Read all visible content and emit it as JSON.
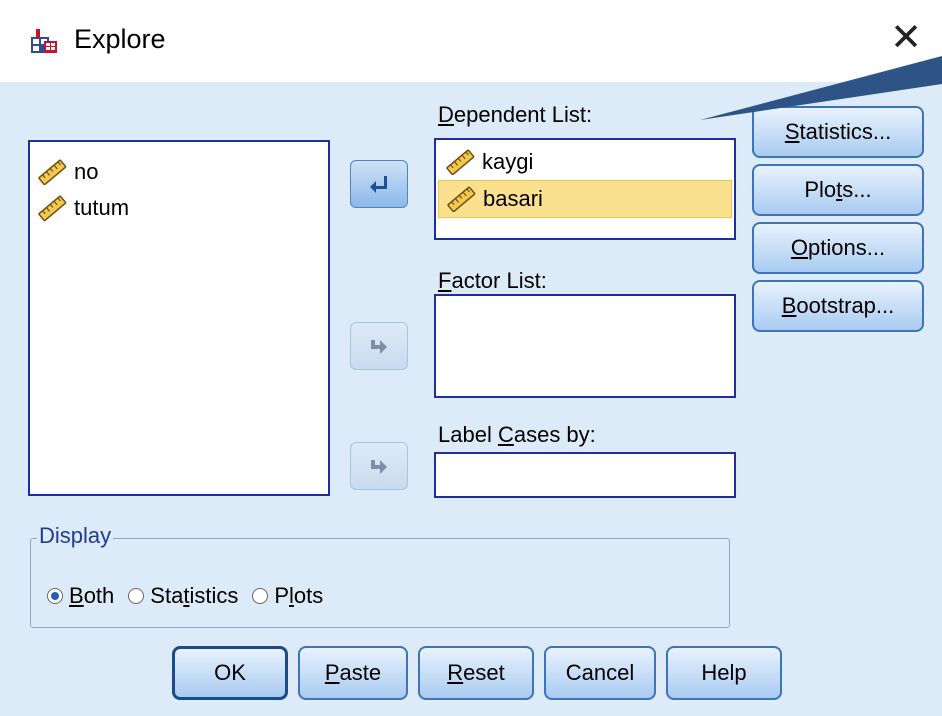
{
  "window": {
    "title": "Explore",
    "close_glyph": "✕",
    "icon": "spss-explore-icon"
  },
  "source_list": {
    "items": [
      {
        "label": "no",
        "icon": "scale-ruler-icon"
      },
      {
        "label": "tutum",
        "icon": "scale-ruler-icon"
      }
    ]
  },
  "dependent_list": {
    "label_pre": "",
    "label_u": "D",
    "label_post": "ependent List:",
    "items": [
      {
        "label": "kaygi",
        "icon": "scale-ruler-icon",
        "selected": false
      },
      {
        "label": "basari",
        "icon": "scale-ruler-icon",
        "selected": true
      }
    ]
  },
  "factor_list": {
    "label_pre": "",
    "label_u": "F",
    "label_post": "actor List:"
  },
  "label_cases": {
    "label_pre": "Label ",
    "label_u": "C",
    "label_post": "ases by:",
    "value": ""
  },
  "side_buttons": [
    {
      "pre": "",
      "u": "S",
      "post": "tatistics..."
    },
    {
      "pre": "Plo",
      "u": "t",
      "post": "s..."
    },
    {
      "pre": "",
      "u": "O",
      "post": "ptions..."
    },
    {
      "pre": "",
      "u": "B",
      "post": "ootstrap..."
    }
  ],
  "display": {
    "legend": "Display",
    "options": [
      {
        "pre": "",
        "u": "B",
        "post": "oth",
        "checked": true
      },
      {
        "pre": "Sta",
        "u": "t",
        "post": "istics",
        "checked": false
      },
      {
        "pre": "P",
        "u": "l",
        "post": "ots",
        "checked": false
      }
    ]
  },
  "bottom_buttons": [
    {
      "pre": "OK",
      "u": "",
      "post": ""
    },
    {
      "pre": "",
      "u": "P",
      "post": "aste"
    },
    {
      "pre": "",
      "u": "R",
      "post": "eset"
    },
    {
      "pre": "Cancel",
      "u": "",
      "post": ""
    },
    {
      "pre": "Help",
      "u": "",
      "post": ""
    }
  ],
  "colors": {
    "dialog_bg": "#dcebf7",
    "selection": "#fbe08e",
    "list_border": "#1c2f9a",
    "callout": "#2e5487"
  }
}
